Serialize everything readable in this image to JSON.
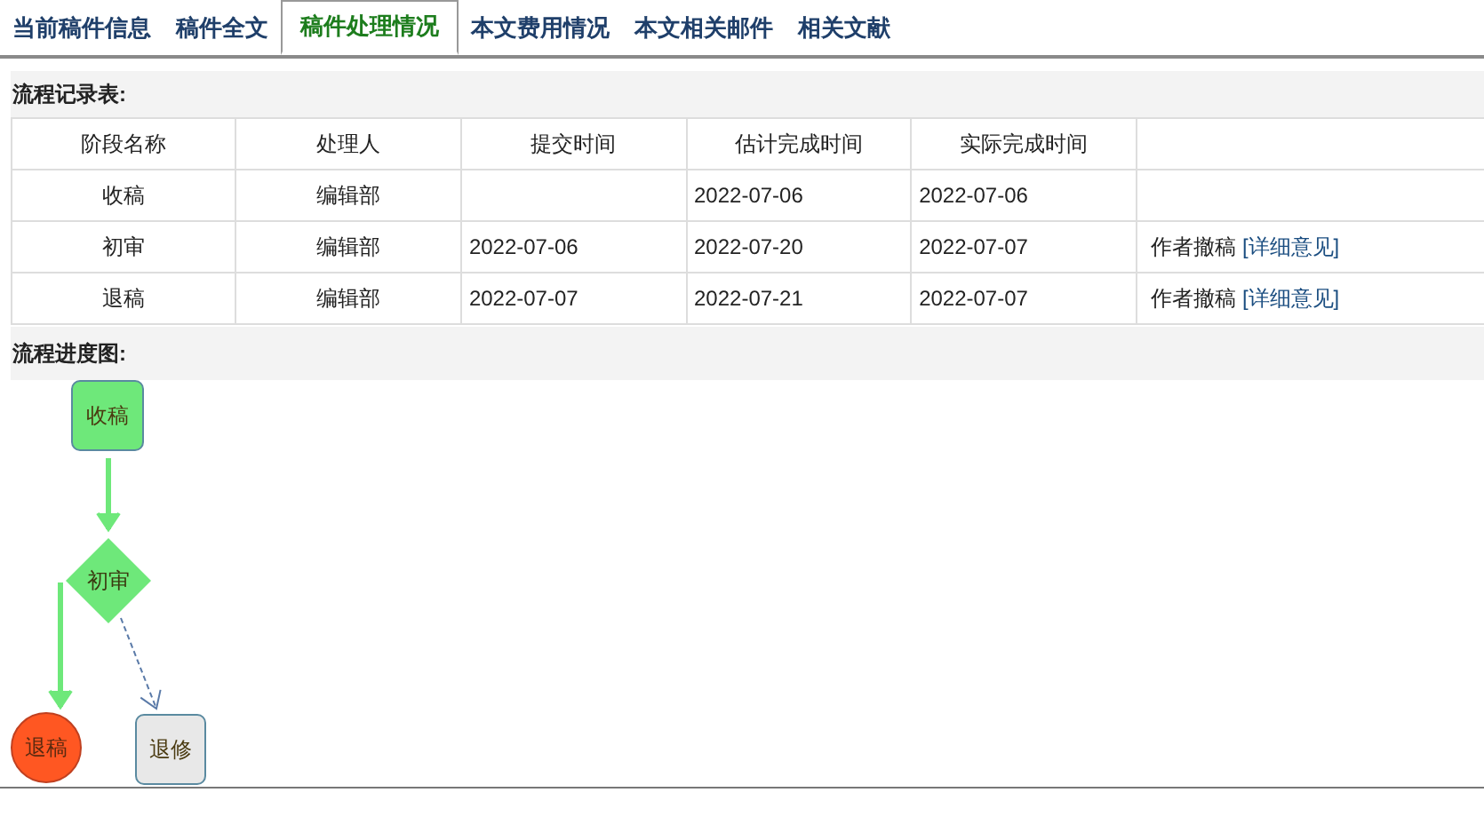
{
  "tabs": [
    {
      "label": "当前稿件信息",
      "selected": false
    },
    {
      "label": "稿件全文",
      "selected": false
    },
    {
      "label": "稿件处理情况",
      "selected": true
    },
    {
      "label": "本文费用情况",
      "selected": false
    },
    {
      "label": "本文相关邮件",
      "selected": false
    },
    {
      "label": "相关文献",
      "selected": false
    }
  ],
  "record_table": {
    "title": "流程记录表:",
    "columns": [
      "阶段名称",
      "处理人",
      "提交时间",
      "估计完成时间",
      "实际完成时间"
    ],
    "rows": [
      {
        "stage": "收稿",
        "handler": "编辑部",
        "estimated": "2022-07-06",
        "actual": "2022-07-06"
      },
      {
        "stage": "初审",
        "handler": "编辑部",
        "submitted": "2022-07-06",
        "estimated": "2022-07-20",
        "actual": "2022-07-07",
        "note": "作者撤稿",
        "link": "[详细意见]"
      },
      {
        "stage": "退稿",
        "handler": "编辑部",
        "submitted": "2022-07-07",
        "estimated": "2022-07-21",
        "actual": "2022-07-07",
        "note": "作者撤稿",
        "link": "[详细意见]"
      }
    ]
  },
  "flow_chart": {
    "title": "流程进度图:",
    "nodes": [
      {
        "label": "收稿",
        "kind": "rect",
        "color": "#6ee87a"
      },
      {
        "label": "初审",
        "kind": "diamond",
        "color": "#6ee87a"
      },
      {
        "label": "退稿",
        "kind": "circle",
        "color": "#ff5722"
      },
      {
        "label": "退修",
        "kind": "rect",
        "color": "#e8e8e8"
      }
    ],
    "edges": [
      {
        "kind": "solid"
      },
      {
        "kind": "solid"
      },
      {
        "kind": "dashed"
      }
    ]
  }
}
